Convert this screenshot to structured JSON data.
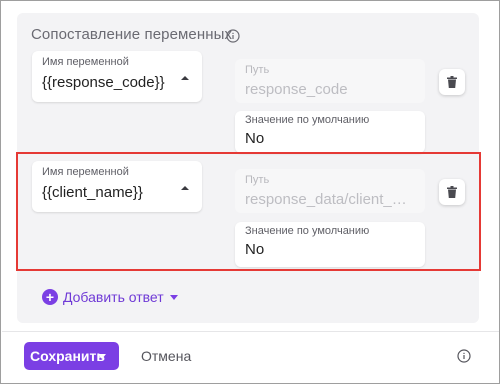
{
  "section": {
    "title": "Сопоставление переменных"
  },
  "rows": [
    {
      "variable_label": "Имя переменной",
      "variable_value": "{{response_code}}",
      "path_label": "Путь",
      "path_value": "response_code",
      "default_label": "Значение по умолчанию",
      "default_value": "No"
    },
    {
      "variable_label": "Имя переменной",
      "variable_value": "{{client_name}}",
      "path_label": "Путь",
      "path_value": "response_data/client_na...",
      "default_label": "Значение по умолчанию",
      "default_value": "No"
    }
  ],
  "add_answer": {
    "label": "Добавить ответ"
  },
  "footer": {
    "save_label": "Сохранить",
    "cancel_label": "Отмена"
  },
  "colors": {
    "accent": "#7b3fe4",
    "highlight": "#e53935"
  },
  "icons": [
    "info-icon",
    "caret-up-icon",
    "trash-icon",
    "plus-circle-icon",
    "chevron-down-icon"
  ]
}
